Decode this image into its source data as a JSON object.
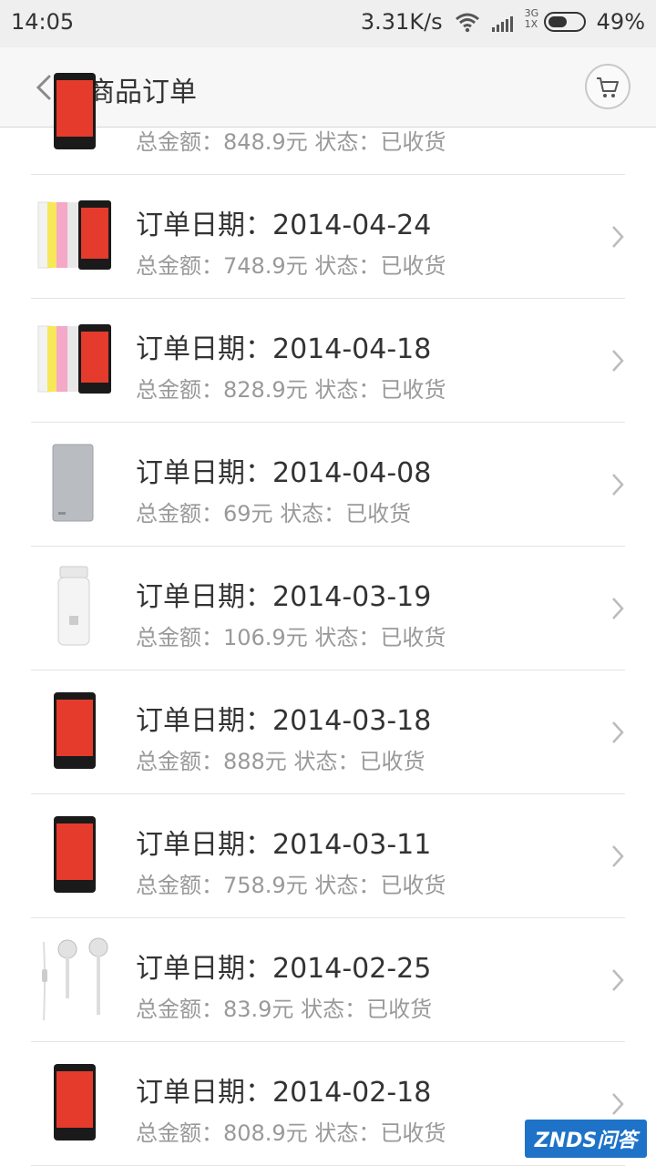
{
  "statusbar": {
    "time": "14:05",
    "net_speed": "3.31K/s",
    "network_types": "3G 1X",
    "battery": "49%"
  },
  "appbar": {
    "title": "商品订单"
  },
  "orders": [
    {
      "date": "",
      "total": "总金额：848.9元",
      "status": "状态：已收货",
      "product_icon": "phone-red-icon"
    },
    {
      "date": "订单日期：2014-04-24",
      "total": "总金额：748.9元",
      "status": "状态：已收货",
      "product_icon": "phone-with-covers-icon"
    },
    {
      "date": "订单日期：2014-04-18",
      "total": "总金额：828.9元",
      "status": "状态：已收货",
      "product_icon": "phone-with-covers-icon"
    },
    {
      "date": "订单日期：2014-04-08",
      "total": "总金额：69元",
      "status": "状态：已收货",
      "product_icon": "power-bank-icon"
    },
    {
      "date": "订单日期：2014-03-19",
      "total": "总金额：106.9元",
      "status": "状态：已收货",
      "product_icon": "water-bottle-icon"
    },
    {
      "date": "订单日期：2014-03-18",
      "total": "总金额：888元",
      "status": "状态：已收货",
      "product_icon": "phone-red-icon"
    },
    {
      "date": "订单日期：2014-03-11",
      "total": "总金额：758.9元",
      "status": "状态：已收货",
      "product_icon": "phone-red-icon"
    },
    {
      "date": "订单日期：2014-02-25",
      "total": "总金额：83.9元",
      "status": "状态：已收货",
      "product_icon": "earphones-icon"
    },
    {
      "date": "订单日期：2014-02-18",
      "total": "总金额：808.9元",
      "status": "状态：已收货",
      "product_icon": "phone-red-icon"
    }
  ],
  "watermark": {
    "text": "ZNDS问答"
  },
  "colors": {
    "accent_red": "#e53b2c",
    "meta_gray": "#999999",
    "watermark_blue": "#1e73c8"
  }
}
